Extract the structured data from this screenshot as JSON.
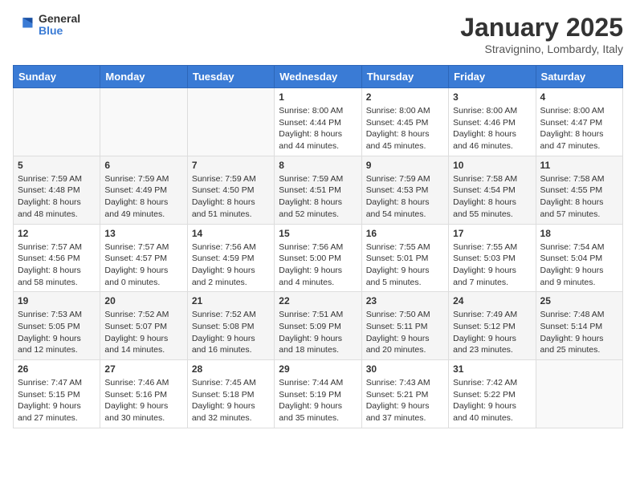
{
  "header": {
    "logo_general": "General",
    "logo_blue": "Blue",
    "title": "January 2025",
    "subtitle": "Stravignino, Lombardy, Italy"
  },
  "days_of_week": [
    "Sunday",
    "Monday",
    "Tuesday",
    "Wednesday",
    "Thursday",
    "Friday",
    "Saturday"
  ],
  "weeks": [
    [
      {
        "day": "",
        "empty": true
      },
      {
        "day": "",
        "empty": true
      },
      {
        "day": "",
        "empty": true
      },
      {
        "day": "1",
        "sunrise": "Sunrise: 8:00 AM",
        "sunset": "Sunset: 4:44 PM",
        "daylight": "Daylight: 8 hours and 44 minutes."
      },
      {
        "day": "2",
        "sunrise": "Sunrise: 8:00 AM",
        "sunset": "Sunset: 4:45 PM",
        "daylight": "Daylight: 8 hours and 45 minutes."
      },
      {
        "day": "3",
        "sunrise": "Sunrise: 8:00 AM",
        "sunset": "Sunset: 4:46 PM",
        "daylight": "Daylight: 8 hours and 46 minutes."
      },
      {
        "day": "4",
        "sunrise": "Sunrise: 8:00 AM",
        "sunset": "Sunset: 4:47 PM",
        "daylight": "Daylight: 8 hours and 47 minutes."
      }
    ],
    [
      {
        "day": "5",
        "sunrise": "Sunrise: 7:59 AM",
        "sunset": "Sunset: 4:48 PM",
        "daylight": "Daylight: 8 hours and 48 minutes."
      },
      {
        "day": "6",
        "sunrise": "Sunrise: 7:59 AM",
        "sunset": "Sunset: 4:49 PM",
        "daylight": "Daylight: 8 hours and 49 minutes."
      },
      {
        "day": "7",
        "sunrise": "Sunrise: 7:59 AM",
        "sunset": "Sunset: 4:50 PM",
        "daylight": "Daylight: 8 hours and 51 minutes."
      },
      {
        "day": "8",
        "sunrise": "Sunrise: 7:59 AM",
        "sunset": "Sunset: 4:51 PM",
        "daylight": "Daylight: 8 hours and 52 minutes."
      },
      {
        "day": "9",
        "sunrise": "Sunrise: 7:59 AM",
        "sunset": "Sunset: 4:53 PM",
        "daylight": "Daylight: 8 hours and 54 minutes."
      },
      {
        "day": "10",
        "sunrise": "Sunrise: 7:58 AM",
        "sunset": "Sunset: 4:54 PM",
        "daylight": "Daylight: 8 hours and 55 minutes."
      },
      {
        "day": "11",
        "sunrise": "Sunrise: 7:58 AM",
        "sunset": "Sunset: 4:55 PM",
        "daylight": "Daylight: 8 hours and 57 minutes."
      }
    ],
    [
      {
        "day": "12",
        "sunrise": "Sunrise: 7:57 AM",
        "sunset": "Sunset: 4:56 PM",
        "daylight": "Daylight: 8 hours and 58 minutes."
      },
      {
        "day": "13",
        "sunrise": "Sunrise: 7:57 AM",
        "sunset": "Sunset: 4:57 PM",
        "daylight": "Daylight: 9 hours and 0 minutes."
      },
      {
        "day": "14",
        "sunrise": "Sunrise: 7:56 AM",
        "sunset": "Sunset: 4:59 PM",
        "daylight": "Daylight: 9 hours and 2 minutes."
      },
      {
        "day": "15",
        "sunrise": "Sunrise: 7:56 AM",
        "sunset": "Sunset: 5:00 PM",
        "daylight": "Daylight: 9 hours and 4 minutes."
      },
      {
        "day": "16",
        "sunrise": "Sunrise: 7:55 AM",
        "sunset": "Sunset: 5:01 PM",
        "daylight": "Daylight: 9 hours and 5 minutes."
      },
      {
        "day": "17",
        "sunrise": "Sunrise: 7:55 AM",
        "sunset": "Sunset: 5:03 PM",
        "daylight": "Daylight: 9 hours and 7 minutes."
      },
      {
        "day": "18",
        "sunrise": "Sunrise: 7:54 AM",
        "sunset": "Sunset: 5:04 PM",
        "daylight": "Daylight: 9 hours and 9 minutes."
      }
    ],
    [
      {
        "day": "19",
        "sunrise": "Sunrise: 7:53 AM",
        "sunset": "Sunset: 5:05 PM",
        "daylight": "Daylight: 9 hours and 12 minutes."
      },
      {
        "day": "20",
        "sunrise": "Sunrise: 7:52 AM",
        "sunset": "Sunset: 5:07 PM",
        "daylight": "Daylight: 9 hours and 14 minutes."
      },
      {
        "day": "21",
        "sunrise": "Sunrise: 7:52 AM",
        "sunset": "Sunset: 5:08 PM",
        "daylight": "Daylight: 9 hours and 16 minutes."
      },
      {
        "day": "22",
        "sunrise": "Sunrise: 7:51 AM",
        "sunset": "Sunset: 5:09 PM",
        "daylight": "Daylight: 9 hours and 18 minutes."
      },
      {
        "day": "23",
        "sunrise": "Sunrise: 7:50 AM",
        "sunset": "Sunset: 5:11 PM",
        "daylight": "Daylight: 9 hours and 20 minutes."
      },
      {
        "day": "24",
        "sunrise": "Sunrise: 7:49 AM",
        "sunset": "Sunset: 5:12 PM",
        "daylight": "Daylight: 9 hours and 23 minutes."
      },
      {
        "day": "25",
        "sunrise": "Sunrise: 7:48 AM",
        "sunset": "Sunset: 5:14 PM",
        "daylight": "Daylight: 9 hours and 25 minutes."
      }
    ],
    [
      {
        "day": "26",
        "sunrise": "Sunrise: 7:47 AM",
        "sunset": "Sunset: 5:15 PM",
        "daylight": "Daylight: 9 hours and 27 minutes."
      },
      {
        "day": "27",
        "sunrise": "Sunrise: 7:46 AM",
        "sunset": "Sunset: 5:16 PM",
        "daylight": "Daylight: 9 hours and 30 minutes."
      },
      {
        "day": "28",
        "sunrise": "Sunrise: 7:45 AM",
        "sunset": "Sunset: 5:18 PM",
        "daylight": "Daylight: 9 hours and 32 minutes."
      },
      {
        "day": "29",
        "sunrise": "Sunrise: 7:44 AM",
        "sunset": "Sunset: 5:19 PM",
        "daylight": "Daylight: 9 hours and 35 minutes."
      },
      {
        "day": "30",
        "sunrise": "Sunrise: 7:43 AM",
        "sunset": "Sunset: 5:21 PM",
        "daylight": "Daylight: 9 hours and 37 minutes."
      },
      {
        "day": "31",
        "sunrise": "Sunrise: 7:42 AM",
        "sunset": "Sunset: 5:22 PM",
        "daylight": "Daylight: 9 hours and 40 minutes."
      },
      {
        "day": "",
        "empty": true
      }
    ]
  ]
}
